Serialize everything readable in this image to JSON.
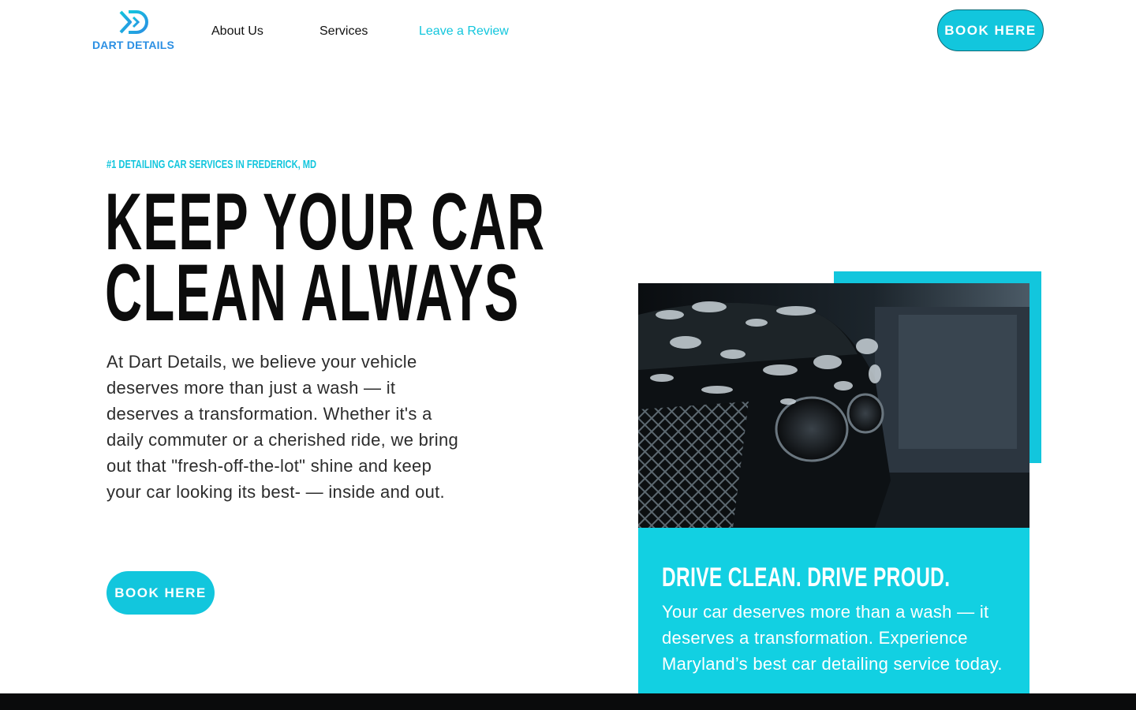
{
  "nav": {
    "logo_text": "DART DETAILS",
    "links": [
      {
        "label": "About Us"
      },
      {
        "label": "Services"
      },
      {
        "label": "Leave a Review"
      }
    ],
    "book_button": "BOOK HERE"
  },
  "hero": {
    "tagline": "#1 DETAILING CAR SERVICES IN FREDERICK, MD",
    "headline_line1": "KEEP YOUR CAR",
    "headline_line2": "CLEAN ALWAYS",
    "description": "At Dart Details, we believe your vehicle deserves more than just a wash — it deserves a transformation. Whether it's a daily commuter or a cherished ride, we bring out that \"fresh-off-the-lot\" shine and keep your car looking its best- — inside and out.",
    "book_button": "BOOK HERE"
  },
  "card": {
    "title": "DRIVE CLEAN. DRIVE PROUD.",
    "text": "Your car deserves more than a wash — it deserves a transformation. Experience Maryland’s best car detailing service today."
  },
  "colors": {
    "accent": "#12c6dd",
    "logo_blue": "#2b8fe3",
    "text_dark": "#0c0c0c"
  }
}
